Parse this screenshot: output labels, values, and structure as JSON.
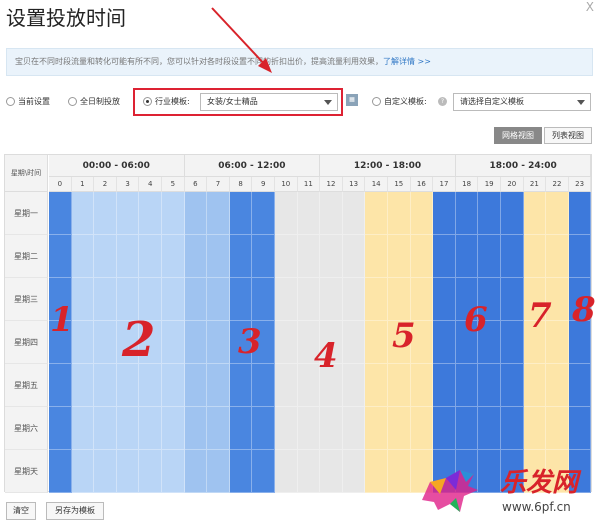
{
  "dialog": {
    "title": "设置投放时间",
    "close_label": "X",
    "info_text": "宝贝在不同时段流量和转化可能有所不同，您可以针对各时段设置不同的折扣出价，提高流量利用效果，",
    "info_link": "了解详情 >>"
  },
  "options": {
    "current_label": "当前设置",
    "allday_label": "全日制投放",
    "industry_label": "行业模板:",
    "industry_value": "女装/女士精品",
    "custom_label": "自定义模板:",
    "custom_placeholder": "请选择自定义模板",
    "selected": "industry"
  },
  "views": {
    "grid_label": "网格视图",
    "list_label": "列表视图",
    "active": "grid"
  },
  "grid": {
    "corner_label": "星期\\时间",
    "bands": [
      "00:00 - 06:00",
      "06:00 - 12:00",
      "12:00 - 18:00",
      "18:00 - 24:00"
    ],
    "hours": [
      "0",
      "1",
      "2",
      "3",
      "4",
      "5",
      "6",
      "7",
      "8",
      "9",
      "10",
      "11",
      "12",
      "13",
      "14",
      "15",
      "16",
      "17",
      "18",
      "19",
      "20",
      "21",
      "22",
      "23"
    ],
    "days": [
      "星期一",
      "星期二",
      "星期三",
      "星期四",
      "星期五",
      "星期六",
      "星期天"
    ],
    "hour_levels": [
      4,
      1,
      1,
      1,
      1,
      1,
      2,
      2,
      4,
      4,
      0,
      0,
      0,
      0,
      3,
      3,
      3,
      5,
      5,
      5,
      5,
      3,
      3,
      5
    ],
    "colors": {
      "0": "#e7e7e7",
      "1": "#b9d5f6",
      "2": "#9fc3f0",
      "3": "#fde5a8",
      "4": "#4a86e0",
      "5": "#3d79db"
    }
  },
  "footer": {
    "clear_label": "清空",
    "save_template_label": "另存为模板"
  },
  "annotations": [
    "1",
    "2",
    "3",
    "4",
    "5",
    "6",
    "7",
    "8"
  ],
  "watermark": {
    "brand": "乐发网",
    "url": "www.6pf.cn"
  }
}
